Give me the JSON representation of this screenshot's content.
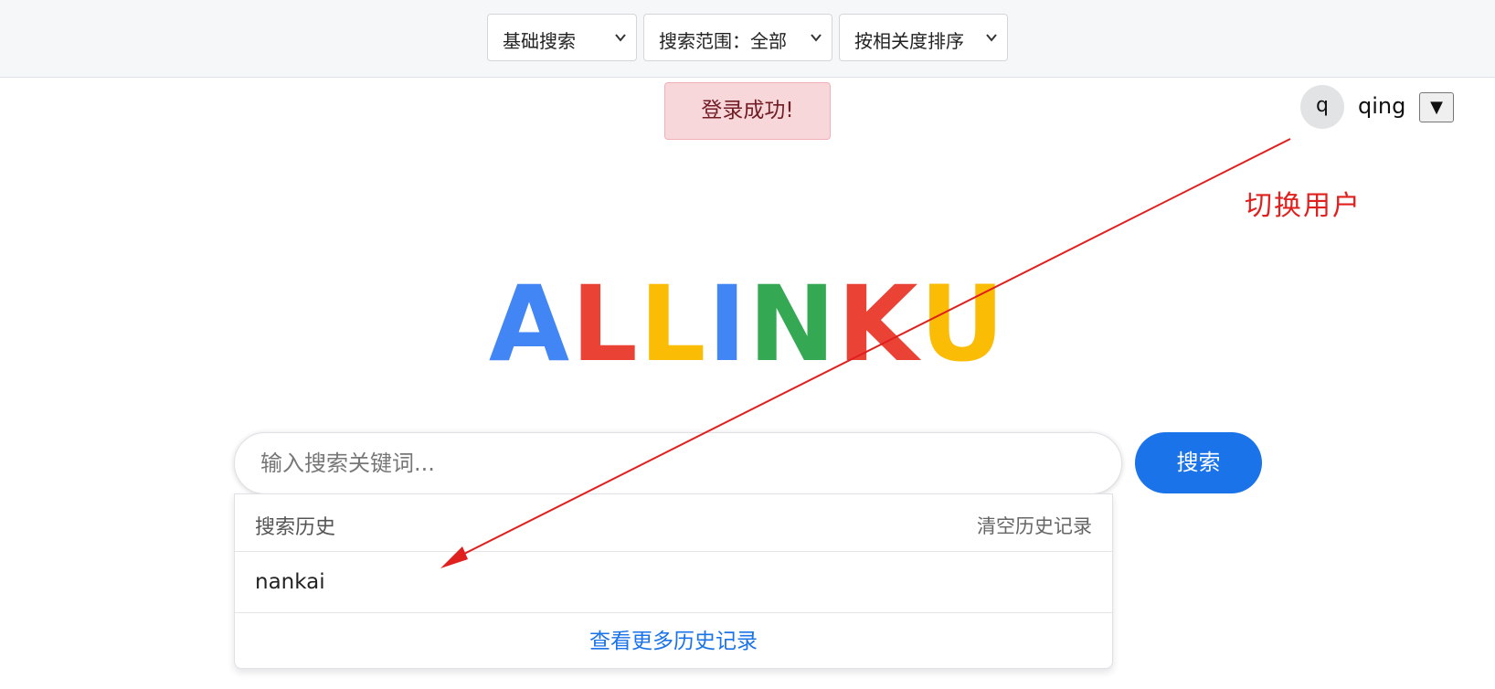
{
  "topbar": {
    "mode_select": {
      "selected": "基础搜索"
    },
    "scope_select": {
      "selected": "搜索范围：全部"
    },
    "sort_select": {
      "selected": "按相关度排序"
    }
  },
  "alert": {
    "message": "登录成功!"
  },
  "user": {
    "avatar_initial": "q",
    "name": "qing",
    "toggle_symbol": "▼"
  },
  "annotation": {
    "text": "切换用户",
    "color": "#e0201e"
  },
  "logo": {
    "letters": [
      {
        "char": "A",
        "color": "#4285f4"
      },
      {
        "char": "L",
        "color": "#ea4335"
      },
      {
        "char": "L",
        "color": "#fbbc05"
      },
      {
        "char": "I",
        "color": "#4285f4"
      },
      {
        "char": "N",
        "color": "#34a853"
      },
      {
        "char": "K",
        "color": "#ea4335"
      },
      {
        "char": "U",
        "color": "#fbbc05"
      }
    ]
  },
  "search": {
    "placeholder": "输入搜索关键词...",
    "button_label": "搜索"
  },
  "history": {
    "title": "搜索历史",
    "clear_label": "清空历史记录",
    "items": [
      "nankai"
    ],
    "more_label": "查看更多历史记录"
  },
  "colors": {
    "primary": "#1a73e8",
    "alert_bg": "#f8d7da",
    "alert_text": "#721c24"
  }
}
